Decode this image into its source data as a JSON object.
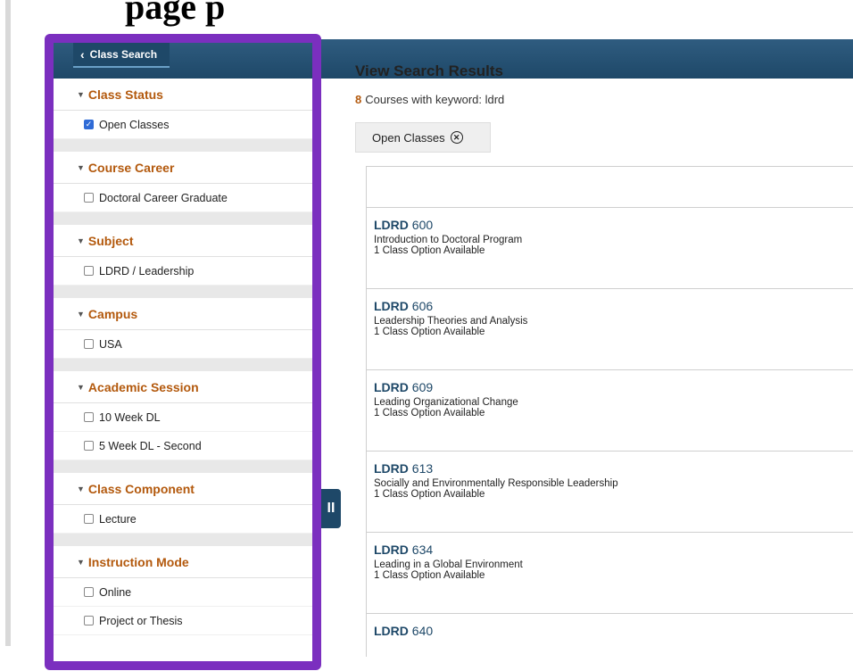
{
  "page": {
    "heading_fragment": "page p"
  },
  "nav": {
    "back_label": "Class Search"
  },
  "filters": [
    {
      "title": "Class Status",
      "options": [
        {
          "label": "Open Classes",
          "checked": true
        }
      ]
    },
    {
      "title": "Course Career",
      "options": [
        {
          "label": "Doctoral Career Graduate",
          "checked": false
        }
      ]
    },
    {
      "title": "Subject",
      "options": [
        {
          "label": "LDRD / Leadership",
          "checked": false
        }
      ]
    },
    {
      "title": "Campus",
      "options": [
        {
          "label": "USA",
          "checked": false
        }
      ]
    },
    {
      "title": "Academic Session",
      "options": [
        {
          "label": "10 Week DL",
          "checked": false
        },
        {
          "label": "5 Week DL - Second",
          "checked": false
        }
      ]
    },
    {
      "title": "Class Component",
      "options": [
        {
          "label": "Lecture",
          "checked": false
        }
      ]
    },
    {
      "title": "Instruction Mode",
      "options": [
        {
          "label": "Online",
          "checked": false
        },
        {
          "label": "Project or Thesis",
          "checked": false
        }
      ]
    }
  ],
  "results": {
    "title": "View Search Results",
    "count": "8",
    "count_text": "Courses with keyword: ldrd",
    "active_filter": "Open Classes",
    "courses": [
      {
        "subject": "LDRD",
        "number": "600",
        "title": "Introduction to Doctoral Program",
        "availability": "1 Class Option Available"
      },
      {
        "subject": "LDRD",
        "number": "606",
        "title": "Leadership Theories and Analysis",
        "availability": "1 Class Option Available"
      },
      {
        "subject": "LDRD",
        "number": "609",
        "title": "Leading Organizational Change",
        "availability": "1 Class Option Available"
      },
      {
        "subject": "LDRD",
        "number": "613",
        "title": "Socially and Environmentally Responsible Leadership",
        "availability": "1 Class Option Available"
      },
      {
        "subject": "LDRD",
        "number": "634",
        "title": "Leading in a Global Environment",
        "availability": "1 Class Option Available"
      },
      {
        "subject": "LDRD",
        "number": "640",
        "title": "",
        "availability": ""
      }
    ]
  },
  "colors": {
    "header_bar": "#1e4868",
    "accent_orange": "#b3590d",
    "highlight_frame": "#7b2fbf"
  }
}
